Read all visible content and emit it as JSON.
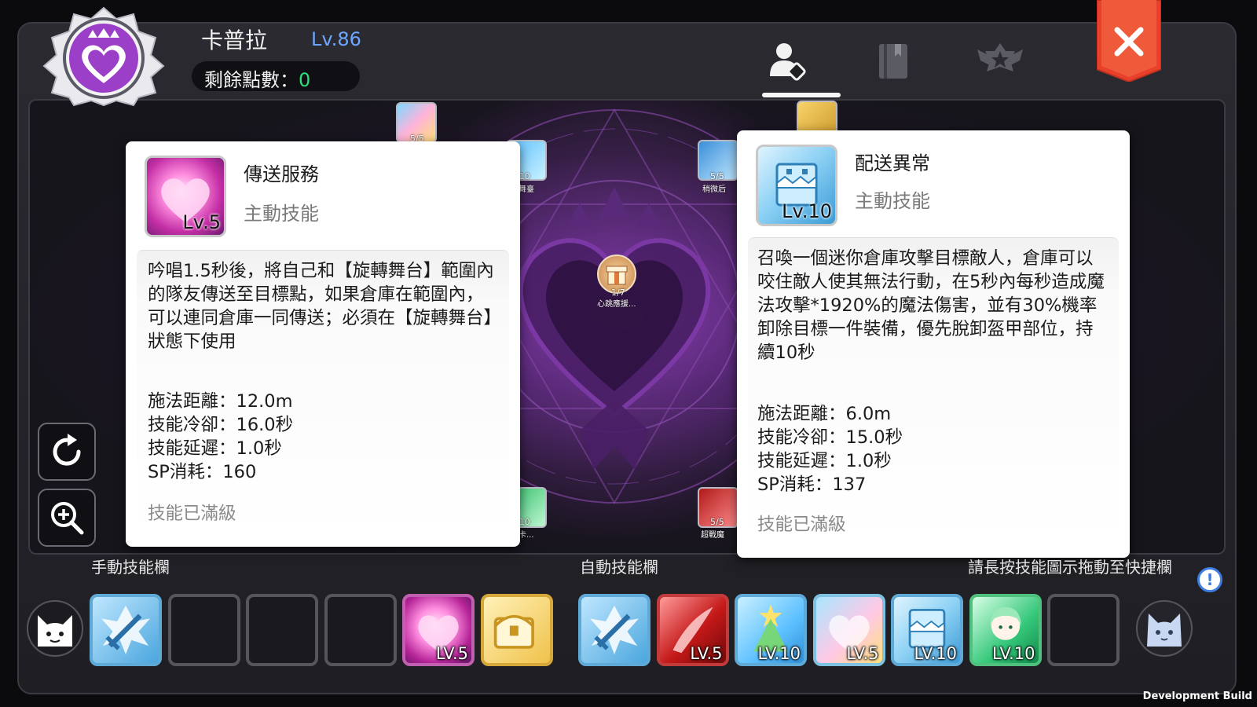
{
  "header": {
    "character_name": "卡普拉",
    "level": "Lv.86",
    "points_label": "剩餘點數：",
    "points_value": "0"
  },
  "tabs": [
    {
      "icon": "character-skill-icon",
      "active": true
    },
    {
      "icon": "book-icon",
      "active": false
    },
    {
      "icon": "emblem-badge-icon",
      "active": false
    }
  ],
  "center_node": {
    "count": "1/7",
    "label": "心跳應援..."
  },
  "tree_nodes": [
    {
      "count": "5/5",
      "label": ""
    },
    {
      "count": "0/10",
      "label": "轉舞臺"
    },
    {
      "count": "5/5",
      "label": "稍微后"
    },
    {
      "count": "0/10",
      "label": "一卡..."
    },
    {
      "count": "5/5",
      "label": "超戰魔"
    }
  ],
  "left_card": {
    "name": "傳送服務",
    "type": "主動技能",
    "icon_level": "Lv.5",
    "description": "吟唱1.5秒後，將自己和【旋轉舞台】範圍內的隊友傳送至目標點，如果倉庫在範圍內，可以連同倉庫一同傳送；必須在【旋轉舞台】狀態下使用",
    "stats": [
      "施法距離：12.0m",
      "技能冷卻：16.0秒",
      "技能延遲：1.0秒",
      "SP消耗：160"
    ],
    "status": "技能已滿級"
  },
  "right_card": {
    "name": "配送異常",
    "type": "主動技能",
    "icon_level": "Lv.10",
    "description": "召喚一個迷你倉庫攻擊目標敵人，倉庫可以咬住敵人使其無法行動，在5秒內每秒造成魔法攻擊*1920%的魔法傷害，並有30%機率卸除目標一件裝備，優先脫卸盔甲部位，持續10秒",
    "stats": [
      "施法距離：6.0m",
      "技能冷卻：15.0秒",
      "技能延遲：1.0秒",
      "SP消耗：137"
    ],
    "status": "技能已滿級"
  },
  "bottom_bar": {
    "manual_label": "手動技能欄",
    "auto_label": "自動技能欄",
    "hint": "請長按技能圖示拖動至快捷欄",
    "manual_slots": [
      {
        "icon": "sword-burst-icon",
        "level": ""
      },
      {
        "icon": "",
        "level": ""
      },
      {
        "icon": "",
        "level": ""
      },
      {
        "icon": "",
        "level": ""
      },
      {
        "icon": "pink-heart-icon",
        "level": "LV.5"
      },
      {
        "icon": "treasure-chest-icon",
        "level": ""
      }
    ],
    "auto_slots": [
      {
        "icon": "sword-burst-icon",
        "level": ""
      },
      {
        "icon": "red-slash-icon",
        "level": "LV.5"
      },
      {
        "icon": "star-tree-icon",
        "level": "LV.10"
      },
      {
        "icon": "rainbow-heart-icon",
        "level": "LV.5"
      },
      {
        "icon": "ice-box-icon",
        "level": "LV.10"
      },
      {
        "icon": "green-girl-icon",
        "level": "LV.10"
      },
      {
        "icon": "",
        "level": ""
      }
    ]
  },
  "footer": {
    "build": "Development Build"
  },
  "colors": {
    "level_blue": "#6ea6ff",
    "points_green": "#29e07a",
    "close_red": "#e8402b",
    "accent_purple": "#9b3fc8"
  }
}
